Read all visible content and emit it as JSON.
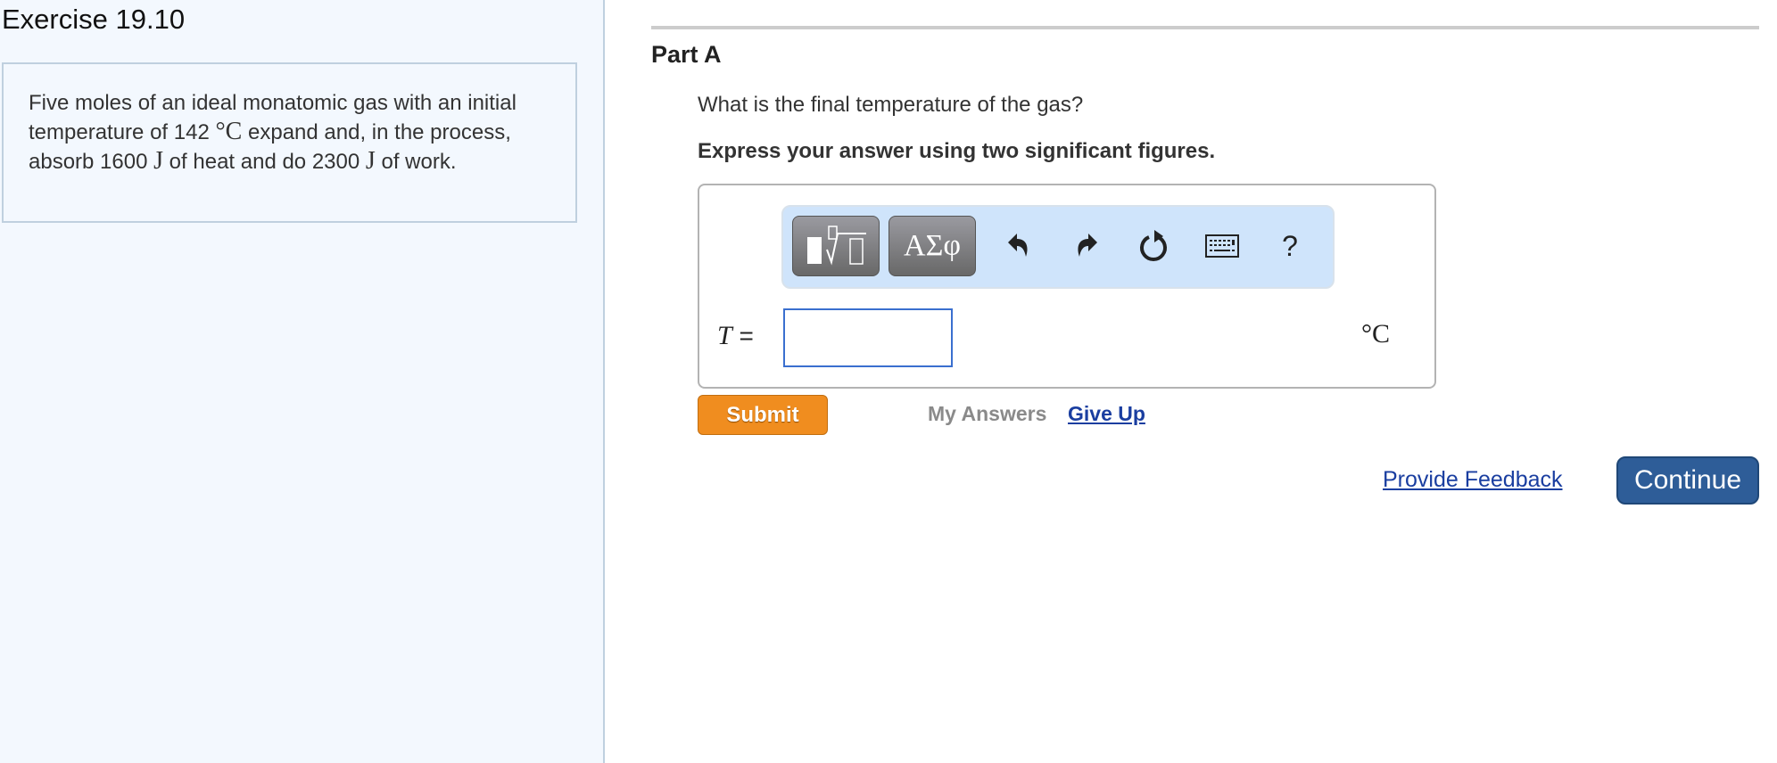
{
  "exercise": {
    "title": "Exercise 19.10",
    "problem": {
      "t1": "Five moles of an ideal monatomic gas with an initial temperature of 142 ",
      "u1": "°C",
      "t2": " expand and, in the process, absorb 1600 ",
      "u2": "J",
      "t3": " of heat and do 2300 ",
      "u3": "J",
      "t4": " of work."
    }
  },
  "part": {
    "label": "Part A",
    "question": "What is the final temperature of the gas?",
    "instruction": "Express your answer using two significant figures."
  },
  "toolbar": {
    "symbols_label": "ΑΣφ",
    "icons": [
      "templates-icon",
      "symbols-icon",
      "undo-icon",
      "redo-icon",
      "reset-icon",
      "keyboard-icon",
      "help-icon"
    ],
    "help_label": "?"
  },
  "answer": {
    "variable": "T",
    "equals": "=",
    "value": "",
    "unit": "°C"
  },
  "actions": {
    "submit": "Submit",
    "my_answers": "My Answers",
    "give_up": "Give Up",
    "provide_feedback": "Provide Feedback",
    "continue": "Continue"
  },
  "colors": {
    "submit": "#f08d1f",
    "continue": "#2e5d98",
    "link": "#1a3ea0",
    "input_border": "#3a6fcf",
    "toolbar_bg": "#cfe4fb"
  }
}
